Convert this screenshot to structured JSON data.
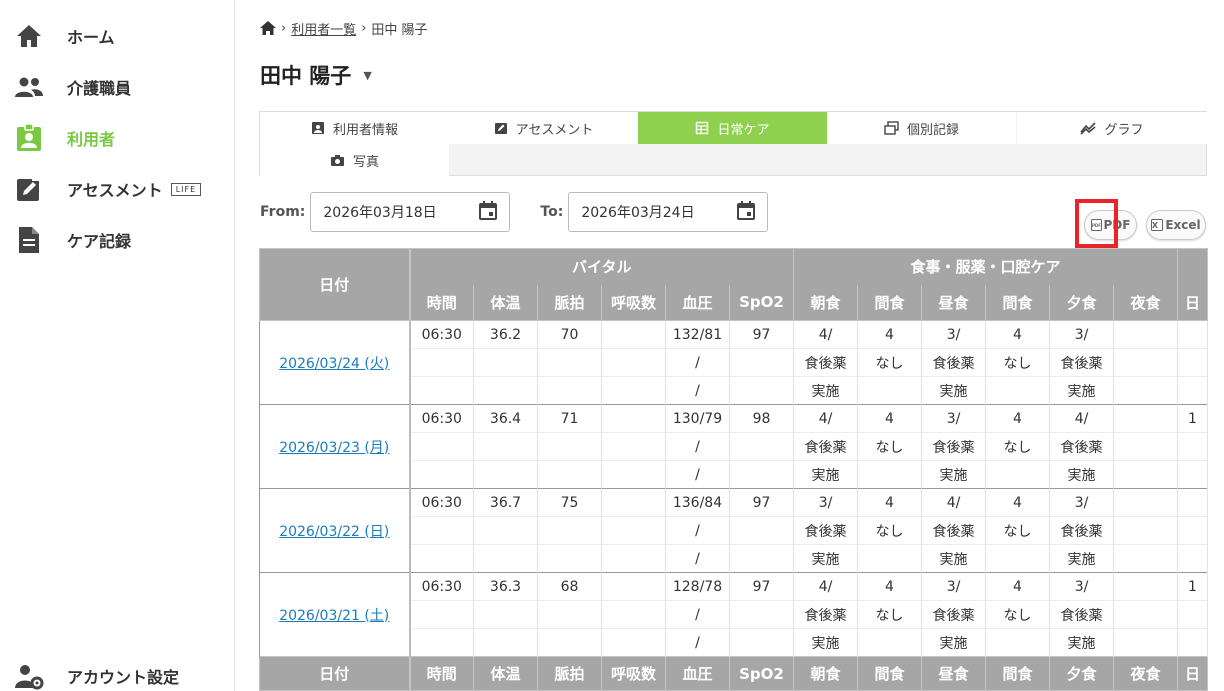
{
  "sidebar": {
    "items": [
      {
        "label": "ホーム",
        "icon": "home-icon"
      },
      {
        "label": "介護職員",
        "icon": "staff-icon"
      },
      {
        "label": "利用者",
        "icon": "user-badge-icon",
        "active": true
      },
      {
        "label": "アセスメント",
        "badge": "LIFE",
        "icon": "edit-icon"
      },
      {
        "label": "ケア記録",
        "icon": "document-icon"
      }
    ],
    "account": {
      "label": "アカウント設定",
      "icon": "account-settings-icon"
    }
  },
  "breadcrumb": {
    "list_link": "利用者一覧",
    "current": "田中 陽子"
  },
  "page": {
    "title": "田中 陽子"
  },
  "tabs": [
    {
      "label": "利用者情報",
      "icon": "id-card-icon"
    },
    {
      "label": "アセスメント",
      "icon": "edit-icon"
    },
    {
      "label": "日常ケア",
      "icon": "calendar-grid-icon",
      "active": true
    },
    {
      "label": "個別記録",
      "icon": "records-icon"
    },
    {
      "label": "グラフ",
      "icon": "graph-icon"
    },
    {
      "label": "写真",
      "icon": "camera-icon"
    }
  ],
  "filters": {
    "from_label": "From:",
    "from_value": "2026年03月18日",
    "to_label": "To:",
    "to_value": "2026年03月24日"
  },
  "export": {
    "pdf": "PDF",
    "excel": "Excel"
  },
  "colors": {
    "accent": "#8fd14f",
    "link": "#1a7bbd",
    "header": "#a6a6a6",
    "highlight": "#e8232a"
  },
  "table": {
    "date_header": "日付",
    "group_vital": "バイタル",
    "group_meal": "食事・服薬・口腔ケア",
    "columns": [
      "時間",
      "体温",
      "脈拍",
      "呼吸数",
      "血圧",
      "SpO2",
      "朝食",
      "間食",
      "昼食",
      "間食",
      "夕食",
      "夜食",
      "日"
    ],
    "rows": [
      {
        "date": "2026/03/24 (火)",
        "lines": [
          [
            "06:30",
            "36.2",
            "70",
            "",
            "132/81",
            "97",
            "4/",
            "4",
            "3/",
            "4",
            "3/",
            "",
            ""
          ],
          [
            "",
            "",
            "",
            "",
            "/",
            "",
            "食後薬",
            "なし",
            "食後薬",
            "なし",
            "食後薬",
            "",
            ""
          ],
          [
            "",
            "",
            "",
            "",
            "/",
            "",
            "実施",
            "",
            "実施",
            "",
            "実施",
            "",
            ""
          ]
        ]
      },
      {
        "date": "2026/03/23 (月)",
        "lines": [
          [
            "06:30",
            "36.4",
            "71",
            "",
            "130/79",
            "98",
            "4/",
            "4",
            "3/",
            "4",
            "4/",
            "",
            "1"
          ],
          [
            "",
            "",
            "",
            "",
            "/",
            "",
            "食後薬",
            "なし",
            "食後薬",
            "なし",
            "食後薬",
            "",
            ""
          ],
          [
            "",
            "",
            "",
            "",
            "/",
            "",
            "実施",
            "",
            "実施",
            "",
            "実施",
            "",
            ""
          ]
        ]
      },
      {
        "date": "2026/03/22 (日)",
        "lines": [
          [
            "06:30",
            "36.7",
            "75",
            "",
            "136/84",
            "97",
            "3/",
            "4",
            "4/",
            "4",
            "3/",
            "",
            ""
          ],
          [
            "",
            "",
            "",
            "",
            "/",
            "",
            "食後薬",
            "なし",
            "食後薬",
            "なし",
            "食後薬",
            "",
            ""
          ],
          [
            "",
            "",
            "",
            "",
            "/",
            "",
            "実施",
            "",
            "実施",
            "",
            "実施",
            "",
            ""
          ]
        ]
      },
      {
        "date": "2026/03/21 (土)",
        "lines": [
          [
            "06:30",
            "36.3",
            "68",
            "",
            "128/78",
            "97",
            "4/",
            "4",
            "3/",
            "4",
            "3/",
            "",
            "1"
          ],
          [
            "",
            "",
            "",
            "",
            "/",
            "",
            "食後薬",
            "なし",
            "食後薬",
            "なし",
            "食後薬",
            "",
            ""
          ],
          [
            "",
            "",
            "",
            "",
            "/",
            "",
            "実施",
            "",
            "実施",
            "",
            "実施",
            "",
            ""
          ]
        ]
      }
    ]
  }
}
